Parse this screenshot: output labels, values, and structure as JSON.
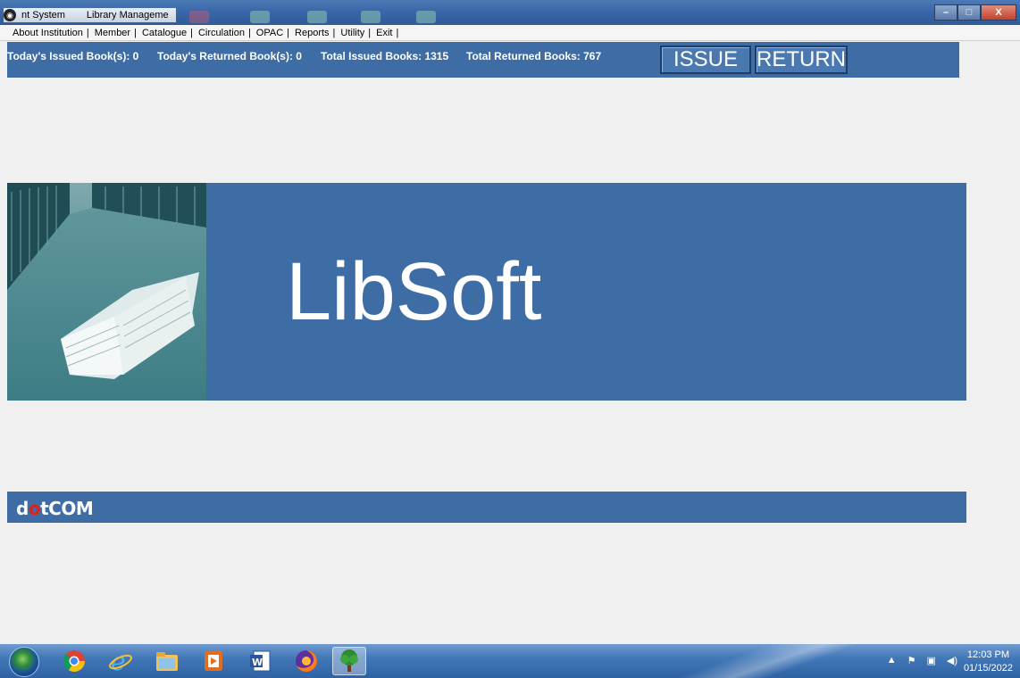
{
  "window": {
    "title_1": "nt System",
    "title_2": "Library Manageme",
    "controls": {
      "minimize": "–",
      "maximize": "□",
      "close": "X"
    }
  },
  "menu": {
    "items": [
      "About Institution",
      "Member",
      "Catalogue",
      "Circulation",
      "OPAC",
      "Reports",
      "Utility",
      "Exit"
    ],
    "separator": "|"
  },
  "stats": {
    "today_issued": "Today's Issued Book(s): 0",
    "today_returned": "Today's Returned Book(s): 0",
    "total_issued": "Total Issued Books: 1315",
    "total_returned": "Total Returned Books: 767"
  },
  "actions": {
    "issue": "ISSUE",
    "return": "RETURN"
  },
  "banner": {
    "title": "LibSoft"
  },
  "brand": {
    "prefix": "d",
    "highlight": "o",
    "suffix": "tCOM"
  },
  "taskbar": {
    "apps": [
      "chrome-icon",
      "internet-explorer-icon",
      "file-explorer-icon",
      "media-player-icon",
      "word-icon",
      "firefox-icon",
      "libsoft-tree-icon"
    ],
    "clock_time": "12:03 PM",
    "clock_date": "01/15/2022"
  },
  "colors": {
    "accent": "#3e6da5",
    "brand_red": "#e0211a",
    "text_light": "#ffffff"
  }
}
